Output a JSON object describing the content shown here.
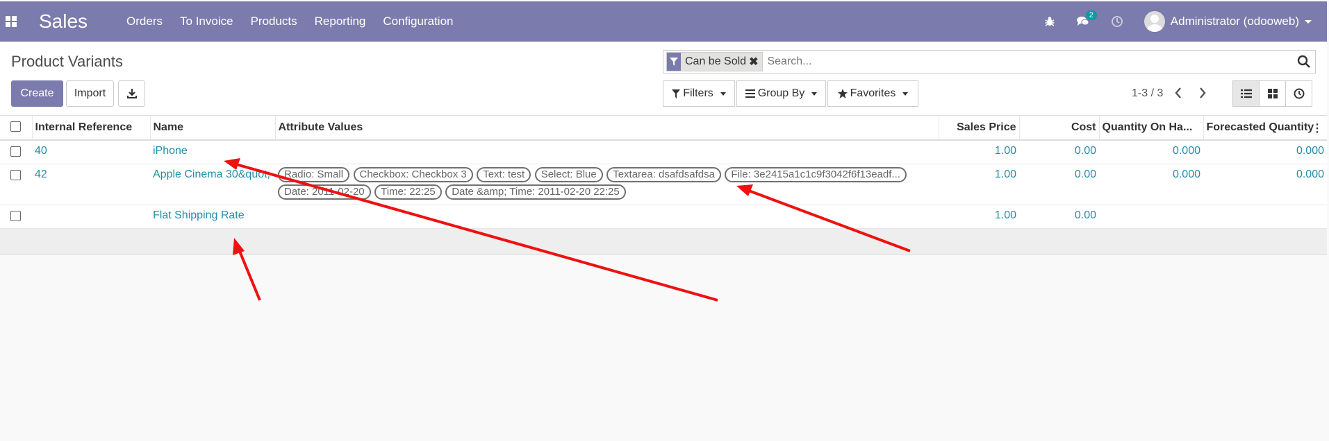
{
  "navbar": {
    "brand": "Sales",
    "menu": [
      "Orders",
      "To Invoice",
      "Products",
      "Reporting",
      "Configuration"
    ],
    "messages_count": "2",
    "user": "Administrator (odooweb)"
  },
  "control": {
    "title": "Product Variants",
    "create_label": "Create",
    "import_label": "Import",
    "facet_label": "Can be Sold",
    "search_placeholder": "Search...",
    "filters_label": "Filters",
    "groupby_label": "Group By",
    "favorites_label": "Favorites",
    "pager": "1-3 / 3"
  },
  "table": {
    "headers": {
      "ref": "Internal Reference",
      "name": "Name",
      "attrs": "Attribute Values",
      "price": "Sales Price",
      "cost": "Cost",
      "qty": "Quantity On Ha...",
      "forecast": "Forecasted Quantity"
    },
    "rows": [
      {
        "ref": "40",
        "name": "iPhone",
        "attributes": [],
        "price": "1.00",
        "cost": "0.00",
        "qty": "0.000",
        "forecast": "0.000"
      },
      {
        "ref": "42",
        "name": "Apple Cinema 30&quot;",
        "attributes": [
          "Radio: Small",
          "Checkbox: Checkbox 3",
          "Text: test",
          "Select: Blue",
          "Textarea: dsafdsafdsa",
          "File: 3e2415a1c1c9f3042f6f13eadf...",
          "Date: 2011-02-20",
          "Time: 22:25",
          "Date &amp; Time: 2011-02-20 22:25"
        ],
        "price": "1.00",
        "cost": "0.00",
        "qty": "0.000",
        "forecast": "0.000"
      },
      {
        "ref": "",
        "name": "Flat Shipping Rate",
        "attributes": [],
        "price": "1.00",
        "cost": "0.00",
        "qty": "",
        "forecast": ""
      }
    ]
  },
  "colors": {
    "navbar": "#7c7bad",
    "link": "#1f8ea8",
    "annotation": "#ee1111"
  }
}
